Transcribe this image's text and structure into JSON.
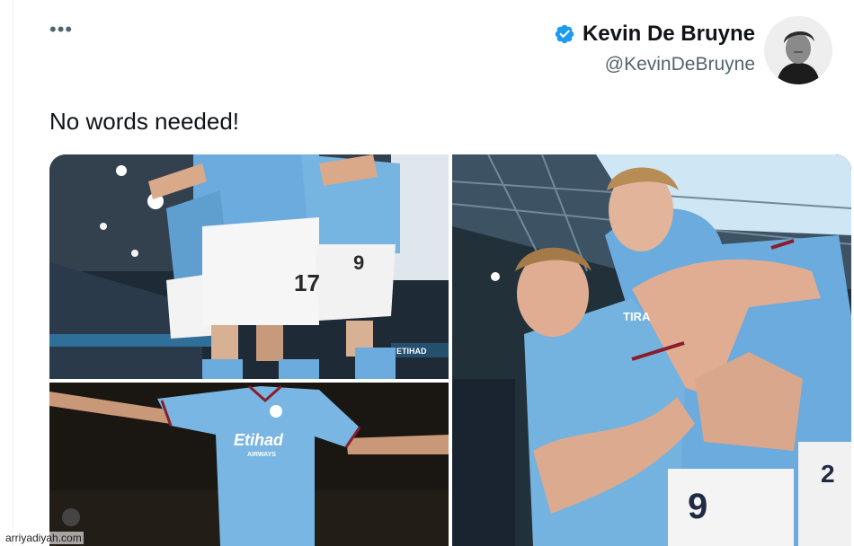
{
  "tweet": {
    "more_label": "•••",
    "author": {
      "display_name": "Kevin De Bruyne",
      "handle": "@KevinDeBruyne",
      "verified": true
    },
    "text": "No words needed!",
    "media": [
      {
        "kind": "photo",
        "position": "top-left"
      },
      {
        "kind": "photo",
        "position": "bottom-left"
      },
      {
        "kind": "photo",
        "position": "right"
      }
    ]
  },
  "photo_text": {
    "shirt_number_left": "17",
    "shirt_number_right": "9",
    "stand_sign": "ETIHAD",
    "sponsor": "Etihad",
    "sponsor_sub": "AIRWAYS",
    "sleeve_text": "TIRA",
    "shirt_number_haaland": "9",
    "shirt_number_partial": "2"
  },
  "watermark": "arriyadiyah.com",
  "colors": {
    "verified_blue": "#1d9bf0",
    "city_blue": "#6cabdd",
    "text_primary": "#0f1419",
    "text_secondary": "#536471"
  },
  "icons": {
    "more": "ellipsis-icon",
    "verified": "verified-badge-icon"
  }
}
